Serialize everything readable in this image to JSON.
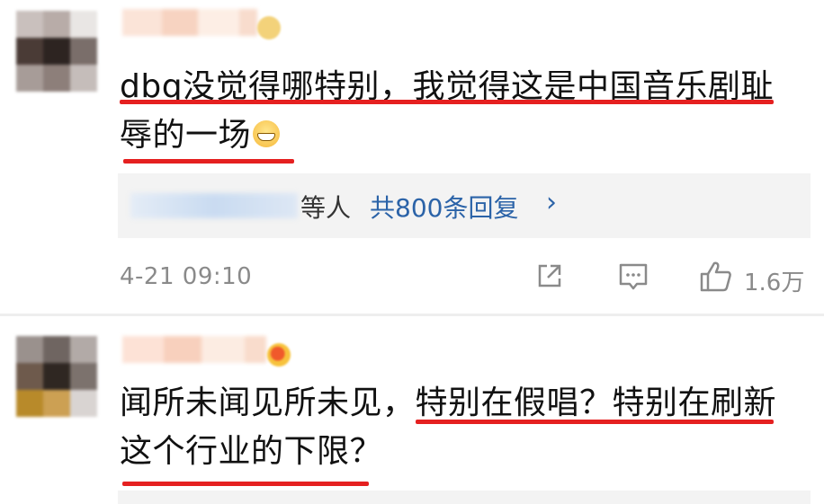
{
  "comments": [
    {
      "text_line1": "dbq没觉得哪特别，我觉得这是中国音乐剧耻",
      "text_line2": "辱的一场",
      "emoji_icon": "grinning-face-icon",
      "replies": {
        "people_suffix": "等人",
        "count_label": "共800条回复",
        "chevron": "›"
      },
      "timestamp": "4-21 09:10",
      "actions": {
        "share_icon": "share-icon",
        "comment_icon": "comment-icon",
        "like_icon": "thumbs-up-icon",
        "like_count": "1.6万"
      }
    },
    {
      "text_line1": "闻所未闻见所未见，特别在假唱？特别在刷新",
      "text_line2": "这个行业的下限？",
      "badge_icon": "user-badge-icon"
    }
  ],
  "colors": {
    "underline": "#e52020",
    "link": "#2b63a8",
    "meta": "#8a8a8a",
    "reply_bg": "#f3f3f3"
  }
}
